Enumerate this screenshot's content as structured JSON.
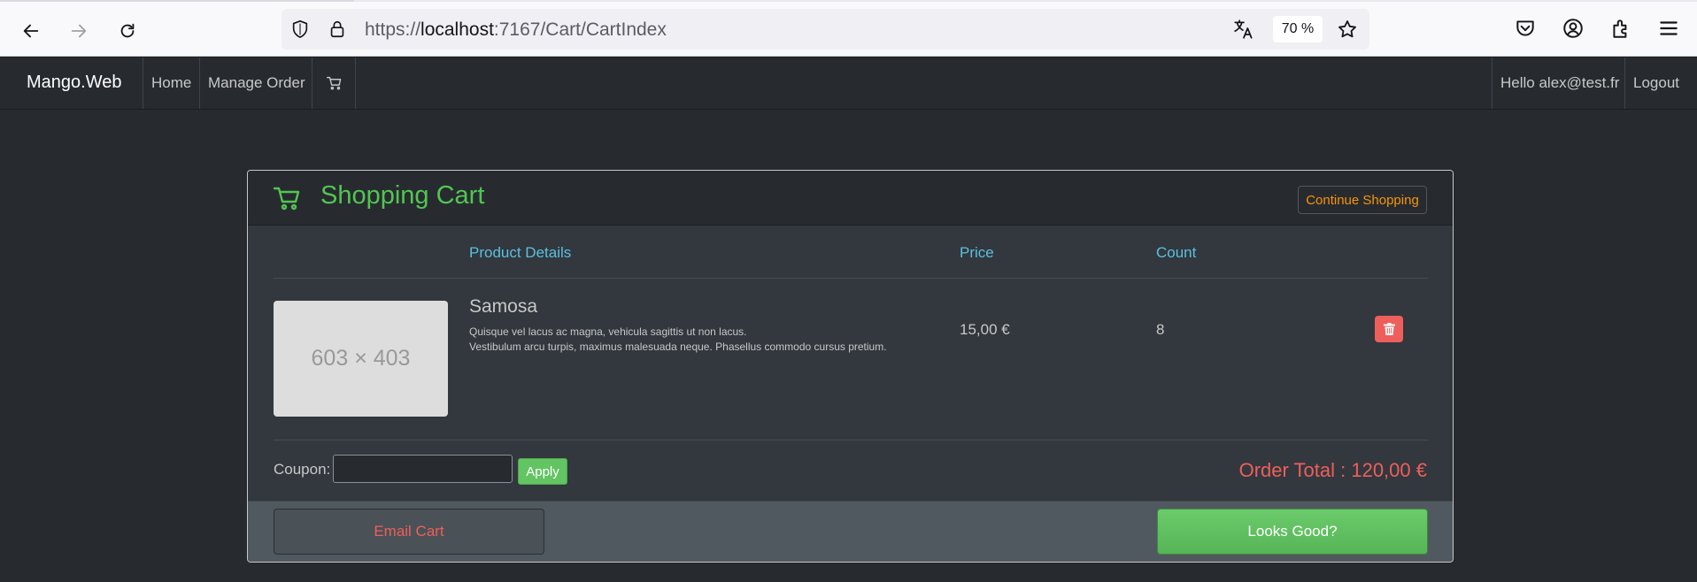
{
  "browser": {
    "url_prefix": "https://",
    "url_host": "localhost",
    "url_path": ":7167/Cart/CartIndex",
    "zoom": "70 %",
    "icons": [
      "back-icon",
      "forward-icon",
      "reload-icon",
      "shield-icon",
      "lock-icon",
      "translate-icon",
      "star-icon",
      "pocket-icon",
      "account-icon",
      "extensions-icon",
      "menu-icon"
    ]
  },
  "navbar": {
    "brand": "Mango.Web",
    "links": [
      "Home",
      "Manage Order"
    ],
    "cart_icon": "cart-icon",
    "greeting": "Hello alex@test.fr",
    "logout": "Logout"
  },
  "cart": {
    "title": "Shopping Cart",
    "continue_label": "Continue Shopping",
    "headers": {
      "details": "Product Details",
      "price": "Price",
      "count": "Count"
    },
    "item": {
      "image_placeholder": "603 × 403",
      "name": "Samosa",
      "desc_line1": "Quisque vel lacus ac magna, vehicula sagittis ut non lacus.",
      "desc_line2": "Vestibulum arcu turpis, maximus malesuada neque. Phasellus commodo cursus pretium.",
      "price": "15,00 €",
      "count": "8",
      "delete_icon": "trash-icon"
    },
    "coupon_label": "Coupon:",
    "coupon_value": "",
    "apply_label": "Apply",
    "order_total": "Order Total : 120,00 €",
    "email_label": "Email Cart",
    "confirm_label": "Looks Good?"
  },
  "colors": {
    "background": "#272b30",
    "title_green": "#52c551",
    "header_blue": "#5bc0de",
    "danger_red": "#ee5f5b",
    "warning_orange": "#f89406"
  }
}
